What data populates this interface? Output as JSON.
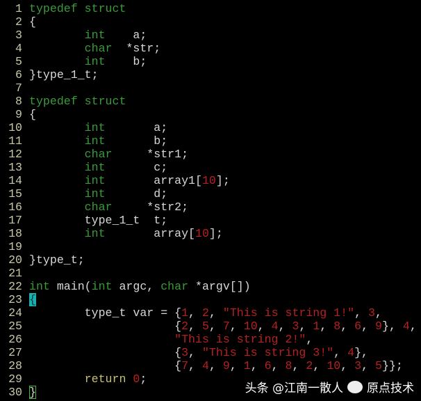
{
  "colors": {
    "background": "#000000",
    "text": "#d8d8d8",
    "keyword": "#3a9a3a",
    "literal": "#b82020",
    "line_number": "#c8c8a8",
    "statement": "#c8c070",
    "match_bracket": "#1ab0b0"
  },
  "watermark": {
    "left": "头条 @江南一散人",
    "right": "原点技术"
  },
  "code": {
    "lines": [
      {
        "no": "1",
        "segs": [
          [
            "k",
            "typedef struct"
          ]
        ]
      },
      {
        "no": "2",
        "segs": [
          [
            "p",
            "{"
          ]
        ]
      },
      {
        "no": "3",
        "segs": [
          [
            "p",
            "        "
          ],
          [
            "k",
            "int"
          ],
          [
            "p",
            "    a;"
          ]
        ]
      },
      {
        "no": "4",
        "segs": [
          [
            "p",
            "        "
          ],
          [
            "k",
            "char"
          ],
          [
            "p",
            "  *str;"
          ]
        ]
      },
      {
        "no": "5",
        "segs": [
          [
            "p",
            "        "
          ],
          [
            "k",
            "int"
          ],
          [
            "p",
            "    b;"
          ]
        ]
      },
      {
        "no": "6",
        "segs": [
          [
            "p",
            "}type_1_t;"
          ]
        ]
      },
      {
        "no": "7",
        "segs": []
      },
      {
        "no": "8",
        "segs": [
          [
            "k",
            "typedef struct"
          ]
        ]
      },
      {
        "no": "9",
        "segs": [
          [
            "p",
            "{"
          ]
        ]
      },
      {
        "no": "10",
        "segs": [
          [
            "p",
            "        "
          ],
          [
            "k",
            "int"
          ],
          [
            "p",
            "       a;"
          ]
        ]
      },
      {
        "no": "11",
        "segs": [
          [
            "p",
            "        "
          ],
          [
            "k",
            "int"
          ],
          [
            "p",
            "       b;"
          ]
        ]
      },
      {
        "no": "12",
        "segs": [
          [
            "p",
            "        "
          ],
          [
            "k",
            "char"
          ],
          [
            "p",
            "     *str1;"
          ]
        ]
      },
      {
        "no": "13",
        "segs": [
          [
            "p",
            "        "
          ],
          [
            "k",
            "int"
          ],
          [
            "p",
            "       c;"
          ]
        ]
      },
      {
        "no": "14",
        "segs": [
          [
            "p",
            "        "
          ],
          [
            "k",
            "int"
          ],
          [
            "p",
            "       array1["
          ],
          [
            "n",
            "10"
          ],
          [
            "p",
            "];"
          ]
        ]
      },
      {
        "no": "15",
        "segs": [
          [
            "p",
            "        "
          ],
          [
            "k",
            "int"
          ],
          [
            "p",
            "       d;"
          ]
        ]
      },
      {
        "no": "16",
        "segs": [
          [
            "p",
            "        "
          ],
          [
            "k",
            "char"
          ],
          [
            "p",
            "     *str2;"
          ]
        ]
      },
      {
        "no": "17",
        "segs": [
          [
            "p",
            "        type_1_t  t;"
          ]
        ]
      },
      {
        "no": "18",
        "segs": [
          [
            "p",
            "        "
          ],
          [
            "k",
            "int"
          ],
          [
            "p",
            "       array["
          ],
          [
            "n",
            "10"
          ],
          [
            "p",
            "];"
          ]
        ]
      },
      {
        "no": "19",
        "segs": []
      },
      {
        "no": "20",
        "segs": [
          [
            "p",
            "}type_t;"
          ]
        ]
      },
      {
        "no": "21",
        "segs": []
      },
      {
        "no": "22",
        "segs": [
          [
            "k",
            "int"
          ],
          [
            "p",
            " main("
          ],
          [
            "k",
            "int"
          ],
          [
            "p",
            " argc, "
          ],
          [
            "k",
            "char"
          ],
          [
            "p",
            " *argv[])"
          ]
        ]
      },
      {
        "no": "23",
        "segs": [
          [
            "m",
            "{"
          ]
        ]
      },
      {
        "no": "24",
        "segs": [
          [
            "p",
            "        type_t var = {"
          ],
          [
            "n",
            "1"
          ],
          [
            "p",
            ", "
          ],
          [
            "n",
            "2"
          ],
          [
            "p",
            ", "
          ],
          [
            "n",
            "\"This is string 1!\""
          ],
          [
            "p",
            ", "
          ],
          [
            "n",
            "3"
          ],
          [
            "p",
            ","
          ]
        ]
      },
      {
        "no": "25",
        "segs": [
          [
            "p",
            "                     {"
          ],
          [
            "n",
            "2"
          ],
          [
            "p",
            ", "
          ],
          [
            "n",
            "5"
          ],
          [
            "p",
            ", "
          ],
          [
            "n",
            "7"
          ],
          [
            "p",
            ", "
          ],
          [
            "n",
            "10"
          ],
          [
            "p",
            ", "
          ],
          [
            "n",
            "4"
          ],
          [
            "p",
            ", "
          ],
          [
            "n",
            "3"
          ],
          [
            "p",
            ", "
          ],
          [
            "n",
            "1"
          ],
          [
            "p",
            ", "
          ],
          [
            "n",
            "8"
          ],
          [
            "p",
            ", "
          ],
          [
            "n",
            "6"
          ],
          [
            "p",
            ", "
          ],
          [
            "n",
            "9"
          ],
          [
            "p",
            "}, "
          ],
          [
            "n",
            "4"
          ],
          [
            "p",
            ","
          ]
        ]
      },
      {
        "no": "26",
        "segs": [
          [
            "p",
            "                     "
          ],
          [
            "n",
            "\"This is string 2!\""
          ],
          [
            "p",
            ","
          ]
        ]
      },
      {
        "no": "27",
        "segs": [
          [
            "p",
            "                     {"
          ],
          [
            "n",
            "3"
          ],
          [
            "p",
            ", "
          ],
          [
            "n",
            "\"This is string 3!\""
          ],
          [
            "p",
            ", "
          ],
          [
            "n",
            "4"
          ],
          [
            "p",
            "},"
          ]
        ]
      },
      {
        "no": "28",
        "segs": [
          [
            "p",
            "                     {"
          ],
          [
            "n",
            "7"
          ],
          [
            "p",
            ", "
          ],
          [
            "n",
            "4"
          ],
          [
            "p",
            ", "
          ],
          [
            "n",
            "9"
          ],
          [
            "p",
            ", "
          ],
          [
            "n",
            "1"
          ],
          [
            "p",
            ", "
          ],
          [
            "n",
            "6"
          ],
          [
            "p",
            ", "
          ],
          [
            "n",
            "8"
          ],
          [
            "p",
            ", "
          ],
          [
            "n",
            "2"
          ],
          [
            "p",
            ", "
          ],
          [
            "n",
            "10"
          ],
          [
            "p",
            ", "
          ],
          [
            "n",
            "3"
          ],
          [
            "p",
            ", "
          ],
          [
            "n",
            "5"
          ],
          [
            "p",
            "}};"
          ]
        ]
      },
      {
        "no": "29",
        "segs": [
          [
            "p",
            "        "
          ],
          [
            "r",
            "return"
          ],
          [
            "p",
            " "
          ],
          [
            "n",
            "0"
          ],
          [
            "p",
            ";"
          ]
        ]
      },
      {
        "no": "30",
        "segs": [
          [
            "c",
            "}"
          ]
        ]
      }
    ]
  }
}
